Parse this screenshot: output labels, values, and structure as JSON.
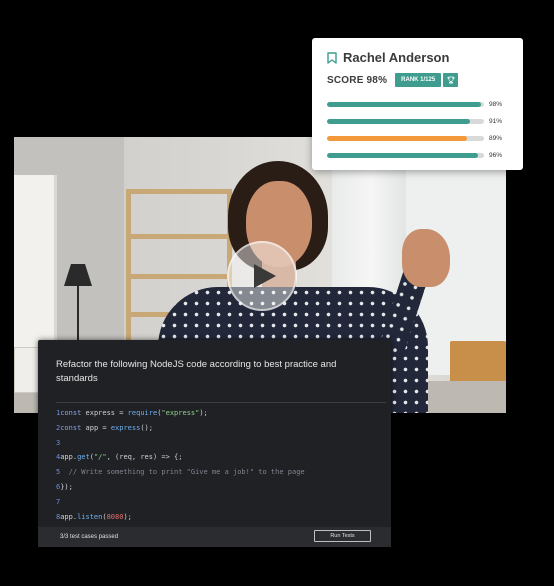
{
  "candidate": {
    "name": "Rachel Anderson",
    "score_label": "SCORE 98%",
    "rank_label": "RANK 1/125"
  },
  "skill_bars": [
    {
      "percent_label": "98%",
      "value": 98,
      "color": "#3e9d8f"
    },
    {
      "percent_label": "91%",
      "value": 91,
      "color": "#3e9d8f"
    },
    {
      "percent_label": "89%",
      "value": 89,
      "color": "#f2993a"
    },
    {
      "percent_label": "96%",
      "value": 96,
      "color": "#3e9d8f"
    }
  ],
  "video": {
    "play_icon": "play-icon"
  },
  "challenge": {
    "prompt": "Refactor the following NodeJS code according to best practice and standards",
    "code_lines": [
      {
        "num": "1",
        "parts": [
          {
            "t": "const ",
            "c": "kw"
          },
          {
            "t": "express = ",
            "c": ""
          },
          {
            "t": "require",
            "c": "fn"
          },
          {
            "t": "(",
            "c": ""
          },
          {
            "t": "\"express\"",
            "c": "str"
          },
          {
            "t": ");",
            "c": ""
          }
        ]
      },
      {
        "num": "2",
        "parts": [
          {
            "t": "const ",
            "c": "kw"
          },
          {
            "t": "app = ",
            "c": ""
          },
          {
            "t": "express",
            "c": "fn"
          },
          {
            "t": "();",
            "c": ""
          }
        ]
      },
      {
        "num": "3",
        "parts": []
      },
      {
        "num": "4",
        "parts": [
          {
            "t": "app.",
            "c": ""
          },
          {
            "t": "get",
            "c": "fn"
          },
          {
            "t": "(",
            "c": ""
          },
          {
            "t": "\"/\"",
            "c": "str"
          },
          {
            "t": ", (req, res) => {;",
            "c": ""
          }
        ]
      },
      {
        "num": "5",
        "parts": [
          {
            "t": "  // Write something to print \"Give me a job!\" to the page",
            "c": "cm"
          }
        ]
      },
      {
        "num": "6",
        "parts": [
          {
            "t": "});",
            "c": ""
          }
        ]
      },
      {
        "num": "7",
        "parts": []
      },
      {
        "num": "8",
        "parts": [
          {
            "t": "app.",
            "c": ""
          },
          {
            "t": "listen",
            "c": "fn"
          },
          {
            "t": "(",
            "c": ""
          },
          {
            "t": "8080",
            "c": "num"
          },
          {
            "t": ");",
            "c": ""
          }
        ]
      }
    ],
    "status": "3/3 test cases passed",
    "run_button_label": "Run Tests"
  }
}
